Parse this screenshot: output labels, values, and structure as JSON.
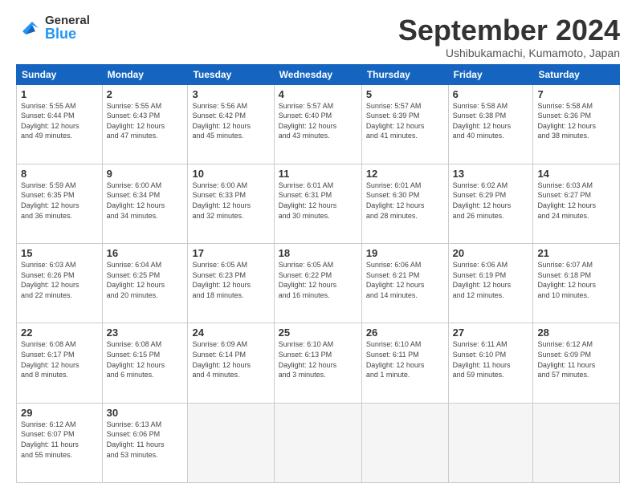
{
  "header": {
    "logo_general": "General",
    "logo_blue": "Blue",
    "month_title": "September 2024",
    "location": "Ushibukamachi, Kumamoto, Japan"
  },
  "weekdays": [
    "Sunday",
    "Monday",
    "Tuesday",
    "Wednesday",
    "Thursday",
    "Friday",
    "Saturday"
  ],
  "weeks": [
    [
      {
        "day": "1",
        "info": "Sunrise: 5:55 AM\nSunset: 6:44 PM\nDaylight: 12 hours\nand 49 minutes."
      },
      {
        "day": "2",
        "info": "Sunrise: 5:55 AM\nSunset: 6:43 PM\nDaylight: 12 hours\nand 47 minutes."
      },
      {
        "day": "3",
        "info": "Sunrise: 5:56 AM\nSunset: 6:42 PM\nDaylight: 12 hours\nand 45 minutes."
      },
      {
        "day": "4",
        "info": "Sunrise: 5:57 AM\nSunset: 6:40 PM\nDaylight: 12 hours\nand 43 minutes."
      },
      {
        "day": "5",
        "info": "Sunrise: 5:57 AM\nSunset: 6:39 PM\nDaylight: 12 hours\nand 41 minutes."
      },
      {
        "day": "6",
        "info": "Sunrise: 5:58 AM\nSunset: 6:38 PM\nDaylight: 12 hours\nand 40 minutes."
      },
      {
        "day": "7",
        "info": "Sunrise: 5:58 AM\nSunset: 6:36 PM\nDaylight: 12 hours\nand 38 minutes."
      }
    ],
    [
      {
        "day": "8",
        "info": "Sunrise: 5:59 AM\nSunset: 6:35 PM\nDaylight: 12 hours\nand 36 minutes."
      },
      {
        "day": "9",
        "info": "Sunrise: 6:00 AM\nSunset: 6:34 PM\nDaylight: 12 hours\nand 34 minutes."
      },
      {
        "day": "10",
        "info": "Sunrise: 6:00 AM\nSunset: 6:33 PM\nDaylight: 12 hours\nand 32 minutes."
      },
      {
        "day": "11",
        "info": "Sunrise: 6:01 AM\nSunset: 6:31 PM\nDaylight: 12 hours\nand 30 minutes."
      },
      {
        "day": "12",
        "info": "Sunrise: 6:01 AM\nSunset: 6:30 PM\nDaylight: 12 hours\nand 28 minutes."
      },
      {
        "day": "13",
        "info": "Sunrise: 6:02 AM\nSunset: 6:29 PM\nDaylight: 12 hours\nand 26 minutes."
      },
      {
        "day": "14",
        "info": "Sunrise: 6:03 AM\nSunset: 6:27 PM\nDaylight: 12 hours\nand 24 minutes."
      }
    ],
    [
      {
        "day": "15",
        "info": "Sunrise: 6:03 AM\nSunset: 6:26 PM\nDaylight: 12 hours\nand 22 minutes."
      },
      {
        "day": "16",
        "info": "Sunrise: 6:04 AM\nSunset: 6:25 PM\nDaylight: 12 hours\nand 20 minutes."
      },
      {
        "day": "17",
        "info": "Sunrise: 6:05 AM\nSunset: 6:23 PM\nDaylight: 12 hours\nand 18 minutes."
      },
      {
        "day": "18",
        "info": "Sunrise: 6:05 AM\nSunset: 6:22 PM\nDaylight: 12 hours\nand 16 minutes."
      },
      {
        "day": "19",
        "info": "Sunrise: 6:06 AM\nSunset: 6:21 PM\nDaylight: 12 hours\nand 14 minutes."
      },
      {
        "day": "20",
        "info": "Sunrise: 6:06 AM\nSunset: 6:19 PM\nDaylight: 12 hours\nand 12 minutes."
      },
      {
        "day": "21",
        "info": "Sunrise: 6:07 AM\nSunset: 6:18 PM\nDaylight: 12 hours\nand 10 minutes."
      }
    ],
    [
      {
        "day": "22",
        "info": "Sunrise: 6:08 AM\nSunset: 6:17 PM\nDaylight: 12 hours\nand 8 minutes."
      },
      {
        "day": "23",
        "info": "Sunrise: 6:08 AM\nSunset: 6:15 PM\nDaylight: 12 hours\nand 6 minutes."
      },
      {
        "day": "24",
        "info": "Sunrise: 6:09 AM\nSunset: 6:14 PM\nDaylight: 12 hours\nand 4 minutes."
      },
      {
        "day": "25",
        "info": "Sunrise: 6:10 AM\nSunset: 6:13 PM\nDaylight: 12 hours\nand 3 minutes."
      },
      {
        "day": "26",
        "info": "Sunrise: 6:10 AM\nSunset: 6:11 PM\nDaylight: 12 hours\nand 1 minute."
      },
      {
        "day": "27",
        "info": "Sunrise: 6:11 AM\nSunset: 6:10 PM\nDaylight: 11 hours\nand 59 minutes."
      },
      {
        "day": "28",
        "info": "Sunrise: 6:12 AM\nSunset: 6:09 PM\nDaylight: 11 hours\nand 57 minutes."
      }
    ],
    [
      {
        "day": "29",
        "info": "Sunrise: 6:12 AM\nSunset: 6:07 PM\nDaylight: 11 hours\nand 55 minutes."
      },
      {
        "day": "30",
        "info": "Sunrise: 6:13 AM\nSunset: 6:06 PM\nDaylight: 11 hours\nand 53 minutes."
      },
      {
        "day": "",
        "info": ""
      },
      {
        "day": "",
        "info": ""
      },
      {
        "day": "",
        "info": ""
      },
      {
        "day": "",
        "info": ""
      },
      {
        "day": "",
        "info": ""
      }
    ]
  ]
}
